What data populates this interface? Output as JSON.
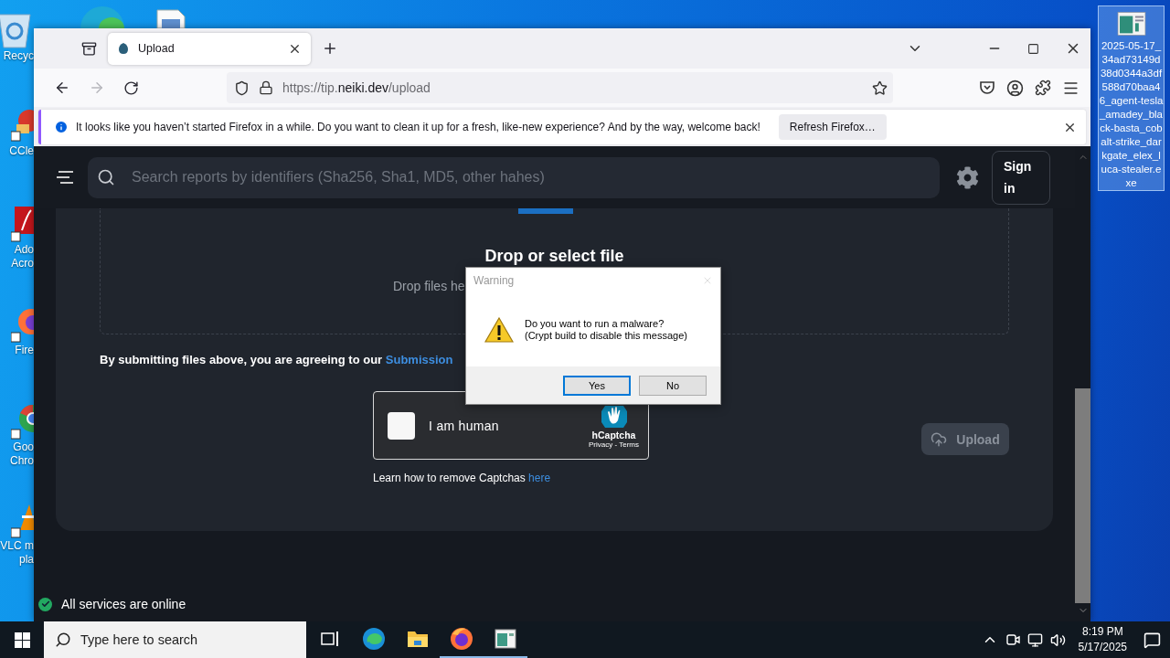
{
  "desktop": {
    "left_icons": [
      {
        "kind": "recycle",
        "label": "Recyc"
      },
      {
        "kind": "ccleaner",
        "label": "CCle"
      },
      {
        "kind": "acrobat",
        "label": "Ado\nAcro"
      },
      {
        "kind": "firefox",
        "label": "Fire"
      },
      {
        "kind": "chrome",
        "label": "Goo\nChro"
      },
      {
        "kind": "vlc",
        "label": "VLC m\npla"
      }
    ],
    "top_icons": [
      {
        "kind": "edge"
      },
      {
        "kind": "document"
      }
    ],
    "file_icon": {
      "label": "2025-05-17_34ad73149d38d0344a3df588d70baa46_agent-tesla_amadey_black-basta_cobalt-strike_darkgate_elex_luca-stealer.exe",
      "selected": true
    }
  },
  "browser": {
    "tabs": [
      {
        "title": "Upload",
        "selected": true
      }
    ],
    "nav_buttons": [
      {
        "kind": "back",
        "disabled": false
      },
      {
        "kind": "forward",
        "disabled": true
      },
      {
        "kind": "reload",
        "disabled": false
      }
    ],
    "url": {
      "prefix": "https://tip.",
      "domain": "neiki.dev",
      "path": "/upload"
    },
    "notification": {
      "message": "It looks like you haven’t started Firefox in a while. Do you want to clean it up for a fresh, like-new experience? And by the way, welcome back!",
      "button": "Refresh Firefox…"
    }
  },
  "page": {
    "search": {
      "placeholder": "Search reports by identifiers (Sha256, Sha1, MD5, other hahes)"
    },
    "sign_in": "Sign in",
    "drop_title": "Drop or select file",
    "drop_hint": "Drop files he",
    "terms_text": "By submitting files above, you are agreeing to our ",
    "terms_link": "Submission",
    "captcha": {
      "label": "I am human",
      "checked": false,
      "brand": "hCaptcha",
      "links": "Privacy - Terms"
    },
    "learn_text": "Learn how to remove Captchas ",
    "learn_link": "here",
    "upload_button": {
      "label": "Upload",
      "disabled": true
    },
    "status": {
      "text": "All services are online",
      "online": true
    }
  },
  "dialog": {
    "title": "Warning",
    "message": "Do you want to run a malware?\n(Crypt build to disable this message)",
    "buttons": [
      {
        "label": "Yes",
        "selected": true
      },
      {
        "label": "No",
        "selected": false
      }
    ]
  },
  "taskbar": {
    "search_placeholder": "Type here to search",
    "apps": [
      {
        "kind": "edge",
        "running": false
      },
      {
        "kind": "explorer",
        "running": false
      },
      {
        "kind": "firefox",
        "running": true
      },
      {
        "kind": "app",
        "running": true
      }
    ],
    "time": "8:19 PM",
    "date": "5/17/2025"
  }
}
